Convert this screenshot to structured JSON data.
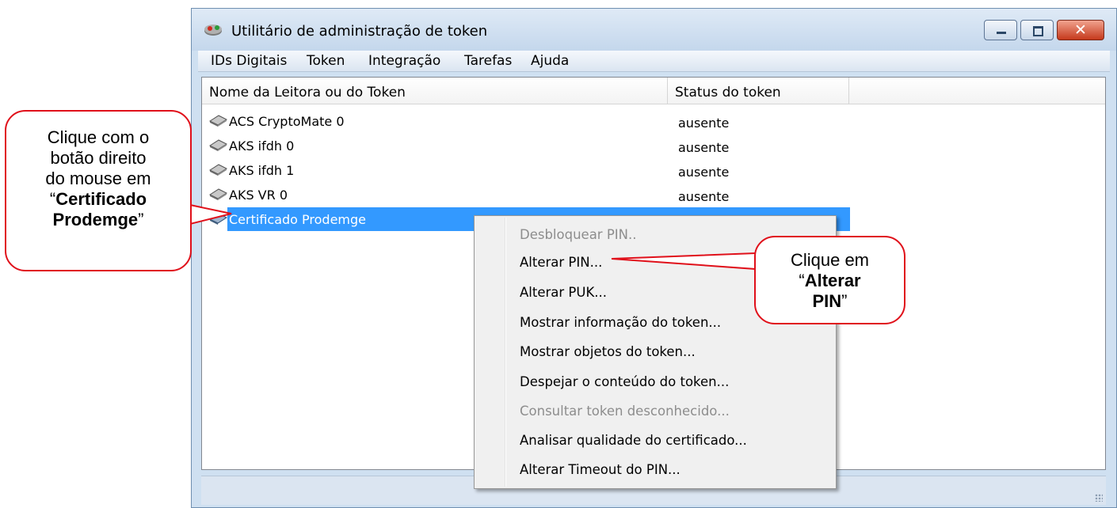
{
  "window": {
    "title": "Utilitário de administração de token",
    "close_glyph": "✕"
  },
  "menubar": {
    "items": [
      "IDs Digitais",
      "Token",
      "Integração",
      "Tarefas",
      "Ajuda"
    ]
  },
  "list": {
    "columns": [
      "Nome da Leitora ou do Token",
      "Status do token"
    ],
    "rows": [
      {
        "name": "ACS CryptoMate 0",
        "status": "ausente"
      },
      {
        "name": "AKS ifdh 0",
        "status": "ausente"
      },
      {
        "name": "AKS ifdh 1",
        "status": "ausente"
      },
      {
        "name": "AKS VR 0",
        "status": "ausente"
      },
      {
        "name": "Certificado Prodemge",
        "status": ""
      }
    ]
  },
  "context_menu": {
    "items": [
      {
        "label": "Desbloquear PIN..",
        "enabled": false
      },
      {
        "label": "Alterar PIN...",
        "enabled": true
      },
      {
        "label": "Alterar PUK...",
        "enabled": true
      },
      {
        "label": "Mostrar informação do token...",
        "enabled": true
      },
      {
        "label": "Mostrar objetos do token...",
        "enabled": true
      },
      {
        "label": "Despejar o conteúdo do token...",
        "enabled": true
      },
      {
        "label": "Consultar token desconhecido...",
        "enabled": false
      },
      {
        "label": "Analisar qualidade do certificado...",
        "enabled": true
      },
      {
        "label": "Alterar Timeout do PIN...",
        "enabled": true
      }
    ]
  },
  "callouts": {
    "left": {
      "line1": "Clique com o",
      "line2": "botão direito",
      "line3": "do mouse em",
      "quote_open": "“",
      "bold1": "Certificado",
      "bold2": "Prodemge",
      "quote_close": "”"
    },
    "right": {
      "line1": "Clique em",
      "quote_open": "“",
      "bold1": "Alterar",
      "bold2": "PIN",
      "quote_close": "”"
    }
  },
  "colors": {
    "selection": "#3399ff",
    "callout_border": "#e0101a",
    "close_button": "#c5391c"
  },
  "icons": [
    "token-app-icon",
    "smartcard-reader-icon"
  ]
}
